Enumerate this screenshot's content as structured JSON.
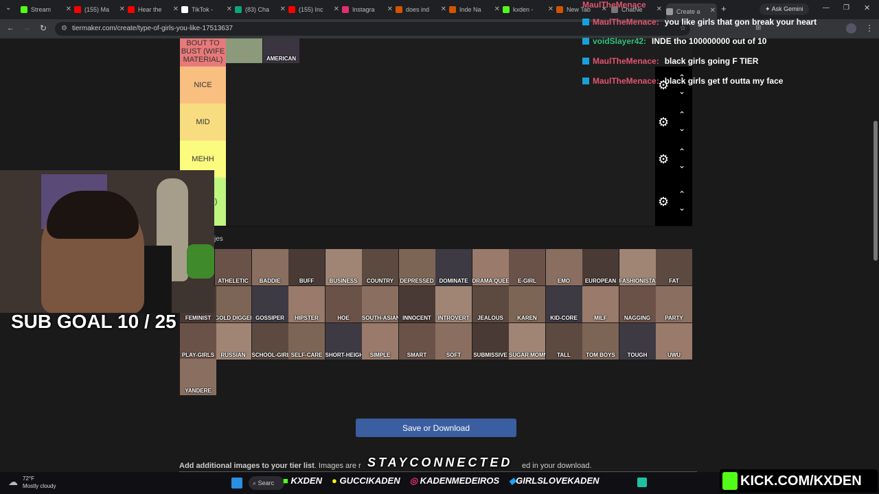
{
  "browser": {
    "tabs": [
      {
        "label": "Stream",
        "color": "#53fc18"
      },
      {
        "label": "(155) Ma",
        "color": "#ff0000"
      },
      {
        "label": "Hear the",
        "color": "#ff0000"
      },
      {
        "label": "TikTok -",
        "color": "#ffffff"
      },
      {
        "label": "(83) Cha",
        "color": "#10a37f"
      },
      {
        "label": "(155) Inc",
        "color": "#ff0000"
      },
      {
        "label": "Instagra",
        "color": "#e1306c"
      },
      {
        "label": "does ind",
        "color": "#d35400"
      },
      {
        "label": "Inde Na",
        "color": "#d35400"
      },
      {
        "label": "kxden -",
        "color": "#53fc18"
      },
      {
        "label": "New Tab",
        "color": "#d35400"
      },
      {
        "label": "ChatNe",
        "color": "#777777"
      },
      {
        "label": "Create a",
        "color": "#999999"
      }
    ],
    "url": "tiermaker.com/create/type-of-girls-you-like-17513637",
    "ask_gemini": "Ask Gemini"
  },
  "tiers": [
    {
      "label": "BOUT TO BUST (WIFE MATERIAL)",
      "color": "#e8797a",
      "items": [
        "",
        "AMERICAN"
      ]
    },
    {
      "label": "NICE",
      "color": "#f9bf80",
      "items": []
    },
    {
      "label": "MID",
      "color": "#f8dd80",
      "items": []
    },
    {
      "label": "MEHH",
      "color": "#fbfb80",
      "items": []
    },
    {
      "label": "Y DOG )",
      "color": "#bff780",
      "items": []
    }
  ],
  "pool_label": "jes",
  "pool_items": [
    "ATHELETIC",
    "BADDIE",
    "BUFF",
    "BUSINESS",
    "COUNTRY",
    "DEPRESSED",
    "DOMINATE",
    "DRAMA QUEEN",
    "E-GIRL",
    "EMO",
    "EUROPEAN",
    "FASHIONISTA",
    "FAT",
    "GOLD DIGGER",
    "GOSSIPER",
    "HIPSTER",
    "HOE",
    "SOUTH-ASIAN",
    "INNOCENT",
    "INTROVERT",
    "JEALOUS",
    "KAREN",
    "KID-CORE",
    "MILF",
    "NAGGING",
    "PARTY",
    "FEMINIST",
    "RUSSIAN",
    "SCHOOL-GIRLS",
    "SELF-CARE",
    "SHORT-HEIGHTED",
    "SIMPLE",
    "SMART",
    "SOFT",
    "SUBMISSIVE",
    "SUGAR MOMMY",
    "TALL",
    "TOM BOYS",
    "TOUGH",
    "UWU",
    "PLAY-GIRLS",
    "YANDERE"
  ],
  "save_button": "Save or Download",
  "add_images_bold": "Add additional images to your tier list",
  "add_images_rest": ". Images are r",
  "add_images_tail": "ed in your download.",
  "chat": [
    {
      "user": "MaulTheMenace",
      "message": "you like girls that gon break your heart",
      "color": "#e05570"
    },
    {
      "user": "voidSlayer42",
      "message": "INDE tho 100000000 out of 10",
      "color": "#2ec27e"
    },
    {
      "user": "MaulTheMenace",
      "message": "black girls going F TIER",
      "color": "#e05570"
    },
    {
      "user": "MaulTheMenace",
      "message": "black girls get tf outta my face",
      "color": "#e05570"
    }
  ],
  "chat_top_user": "MaulTheMenace",
  "sub_goal": "SUB GOAL 10 / 25",
  "stay_connected": "STAYCONNECTED",
  "weather": {
    "temp": "72°F",
    "desc": "Mostly cloudy"
  },
  "search_label": "Searc",
  "socials": [
    "KXDEN",
    "GUCCIKADEN",
    "KADENMEDEIROS",
    "GIRLSLOVEKADEN"
  ],
  "kick_banner": "KICK.COM/KXDEN"
}
